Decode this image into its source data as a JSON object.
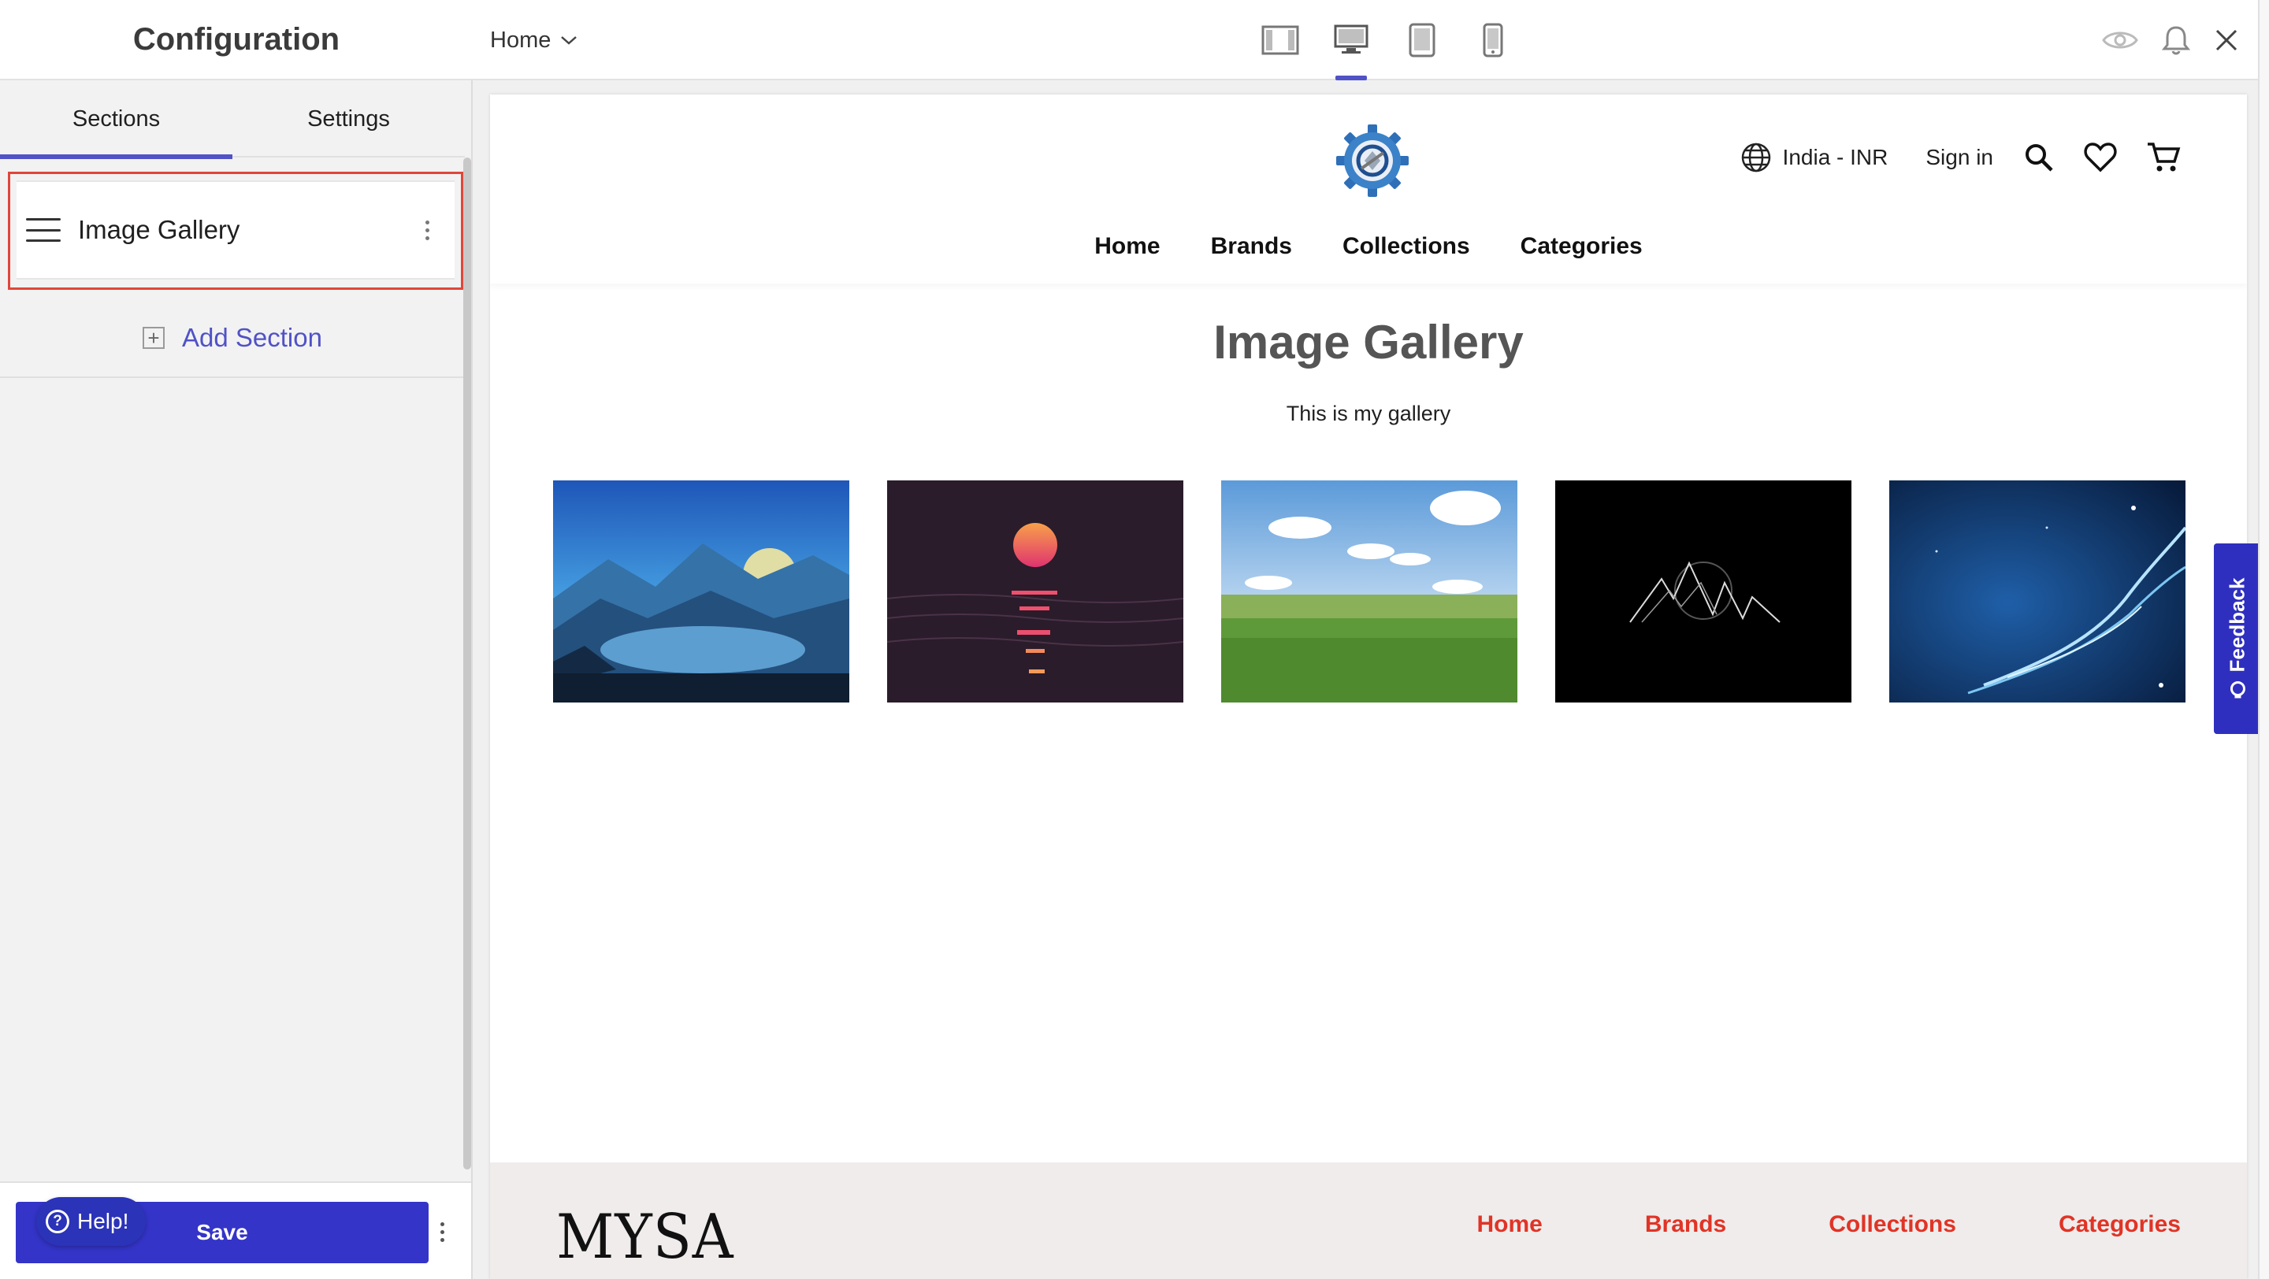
{
  "config_panel": {
    "title": "Configuration",
    "tabs": [
      {
        "label": "Sections",
        "active": true
      },
      {
        "label": "Settings",
        "active": false
      }
    ],
    "sections": [
      {
        "label": "Image Gallery",
        "selected": true
      }
    ],
    "add_section_label": "Add Section",
    "save_label": "Save",
    "help_label": "Help!"
  },
  "toolbar": {
    "page_selector": "Home",
    "devices": [
      {
        "icon": "sidebar-layout-icon",
        "active": false
      },
      {
        "icon": "desktop-icon",
        "active": true
      },
      {
        "icon": "tablet-icon",
        "active": false
      },
      {
        "icon": "mobile-icon",
        "active": false
      }
    ],
    "right_icons": [
      "eye-icon",
      "bell-icon",
      "close-icon"
    ]
  },
  "store": {
    "locale": "India - INR",
    "sign_in": "Sign in",
    "nav": [
      "Home",
      "Brands",
      "Collections",
      "Categories"
    ],
    "gallery_title": "Image Gallery",
    "gallery_subtitle": "This is my gallery",
    "gallery_images": [
      "mountain-lake-image",
      "sunset-sea-image",
      "green-meadow-image",
      "line-mountains-image",
      "blue-light-wave-image"
    ],
    "footer_logo": "MYSA",
    "footer_nav": [
      "Home",
      "Brands",
      "Collections",
      "Categories"
    ]
  },
  "feedback_label": "Feedback",
  "colors": {
    "accent": "#5052c6",
    "save": "#3434c8",
    "footer_link": "#e03426",
    "selection_border": "#e0463a"
  }
}
